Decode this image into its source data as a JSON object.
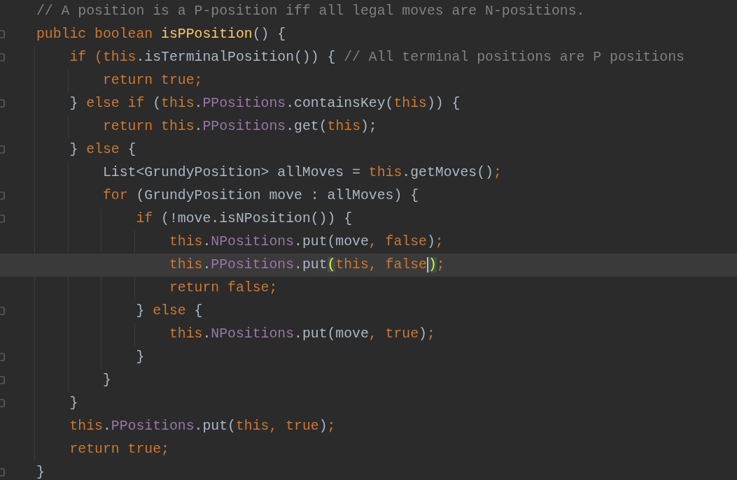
{
  "editor": {
    "lines": [
      {
        "fold": false,
        "current": false,
        "tokens": [
          {
            "text": "// A position is a P-position iff all legal moves are N-positions.",
            "kind": "comment"
          }
        ]
      },
      {
        "fold": true,
        "current": false,
        "tokens": [
          {
            "text": "public boolean ",
            "kind": "keyword"
          },
          {
            "text": "isPPosition",
            "kind": "decl"
          },
          {
            "text": "() {",
            "kind": "plain"
          }
        ]
      },
      {
        "fold": true,
        "current": false,
        "tokens": [
          {
            "text": "    if (",
            "kind": "keyword"
          },
          {
            "text": "this",
            "kind": "keyword"
          },
          {
            "text": ".isTerminalPosition()) { ",
            "kind": "plain"
          },
          {
            "text": "// All terminal positions are P positions",
            "kind": "comment"
          }
        ]
      },
      {
        "fold": false,
        "current": false,
        "tokens": [
          {
            "text": "        return true;",
            "kind": "keyword"
          }
        ]
      },
      {
        "fold": true,
        "current": false,
        "tokens": [
          {
            "text": "    } ",
            "kind": "plain"
          },
          {
            "text": "else if ",
            "kind": "keyword"
          },
          {
            "text": "(",
            "kind": "plain"
          },
          {
            "text": "this",
            "kind": "keyword"
          },
          {
            "text": ".",
            "kind": "plain"
          },
          {
            "text": "PPositions",
            "kind": "field"
          },
          {
            "text": ".containsKey(",
            "kind": "plain"
          },
          {
            "text": "this",
            "kind": "keyword"
          },
          {
            "text": ")) {",
            "kind": "plain"
          }
        ]
      },
      {
        "fold": false,
        "current": false,
        "tokens": [
          {
            "text": "        return ",
            "kind": "keyword"
          },
          {
            "text": "this",
            "kind": "keyword"
          },
          {
            "text": ".",
            "kind": "plain"
          },
          {
            "text": "PPositions",
            "kind": "field"
          },
          {
            "text": ".get(",
            "kind": "plain"
          },
          {
            "text": "this",
            "kind": "keyword"
          },
          {
            "text": ");",
            "kind": "plain"
          }
        ]
      },
      {
        "fold": true,
        "current": false,
        "tokens": [
          {
            "text": "    } ",
            "kind": "plain"
          },
          {
            "text": "else ",
            "kind": "keyword"
          },
          {
            "text": "{",
            "kind": "plain"
          }
        ]
      },
      {
        "fold": false,
        "current": false,
        "tokens": [
          {
            "text": "        List<GrundyPosition> allMoves = ",
            "kind": "plain"
          },
          {
            "text": "this",
            "kind": "keyword"
          },
          {
            "text": ".getMoves()",
            "kind": "plain"
          },
          {
            "text": ";",
            "kind": "keyword"
          }
        ]
      },
      {
        "fold": true,
        "current": false,
        "tokens": [
          {
            "text": "        for ",
            "kind": "keyword"
          },
          {
            "text": "(GrundyPosition move : allMoves) {",
            "kind": "plain"
          }
        ]
      },
      {
        "fold": true,
        "current": false,
        "tokens": [
          {
            "text": "            if ",
            "kind": "keyword"
          },
          {
            "text": "(!move.isNPosition()) {",
            "kind": "plain"
          }
        ]
      },
      {
        "fold": false,
        "current": false,
        "tokens": [
          {
            "text": "                this",
            "kind": "keyword"
          },
          {
            "text": ".",
            "kind": "plain"
          },
          {
            "text": "NPositions",
            "kind": "field"
          },
          {
            "text": ".put(move",
            "kind": "plain"
          },
          {
            "text": ", false",
            "kind": "keyword"
          },
          {
            "text": ")",
            "kind": "plain"
          },
          {
            "text": ";",
            "kind": "keyword"
          }
        ]
      },
      {
        "fold": false,
        "current": true,
        "tokens": [
          {
            "text": "                this",
            "kind": "keyword"
          },
          {
            "text": ".",
            "kind": "plain"
          },
          {
            "text": "PPositions",
            "kind": "field"
          },
          {
            "text": ".put",
            "kind": "plain"
          },
          {
            "text": "(",
            "kind": "plain",
            "matched": true,
            "caret": false
          },
          {
            "text": "this, false",
            "kind": "keyword"
          },
          {
            "text": ")",
            "kind": "plain",
            "matched": true,
            "caret": true
          },
          {
            "text": ";",
            "kind": "keyword"
          }
        ]
      },
      {
        "fold": false,
        "current": false,
        "tokens": [
          {
            "text": "                return false;",
            "kind": "keyword"
          }
        ]
      },
      {
        "fold": true,
        "current": false,
        "tokens": [
          {
            "text": "            } ",
            "kind": "plain"
          },
          {
            "text": "else ",
            "kind": "keyword"
          },
          {
            "text": "{",
            "kind": "plain"
          }
        ]
      },
      {
        "fold": false,
        "current": false,
        "tokens": [
          {
            "text": "                this",
            "kind": "keyword"
          },
          {
            "text": ".",
            "kind": "plain"
          },
          {
            "text": "NPositions",
            "kind": "field"
          },
          {
            "text": ".put(move",
            "kind": "plain"
          },
          {
            "text": ", true",
            "kind": "keyword"
          },
          {
            "text": ")",
            "kind": "plain"
          },
          {
            "text": ";",
            "kind": "keyword"
          }
        ]
      },
      {
        "fold": true,
        "current": false,
        "tokens": [
          {
            "text": "            }",
            "kind": "plain"
          }
        ]
      },
      {
        "fold": true,
        "current": false,
        "tokens": [
          {
            "text": "        }",
            "kind": "plain"
          }
        ]
      },
      {
        "fold": true,
        "current": false,
        "tokens": [
          {
            "text": "    }",
            "kind": "plain"
          }
        ]
      },
      {
        "fold": false,
        "current": false,
        "tokens": [
          {
            "text": "    this",
            "kind": "keyword"
          },
          {
            "text": ".",
            "kind": "plain"
          },
          {
            "text": "PPositions",
            "kind": "field"
          },
          {
            "text": ".put(",
            "kind": "plain"
          },
          {
            "text": "this, true",
            "kind": "keyword"
          },
          {
            "text": ")",
            "kind": "plain"
          },
          {
            "text": ";",
            "kind": "keyword"
          }
        ]
      },
      {
        "fold": false,
        "current": false,
        "tokens": [
          {
            "text": "    return true;",
            "kind": "keyword"
          }
        ]
      },
      {
        "fold": true,
        "current": false,
        "tokens": [
          {
            "text": "}",
            "kind": "plain"
          }
        ]
      }
    ]
  }
}
